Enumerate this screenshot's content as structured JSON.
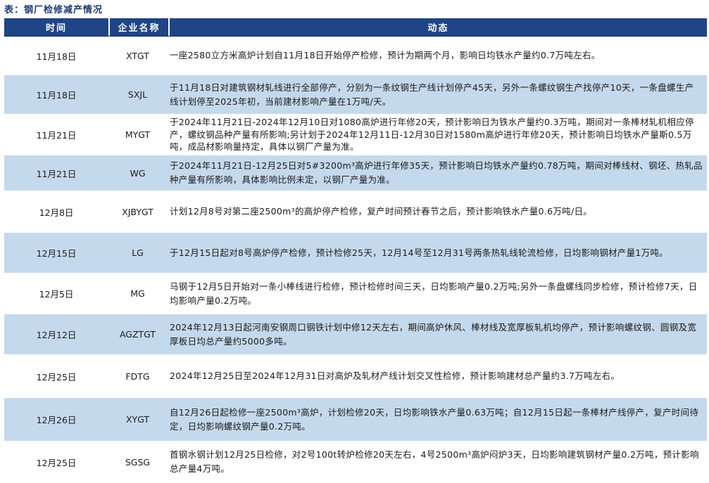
{
  "caption": "表：钢厂检修减产情况",
  "colors": {
    "header_bg": "#1f4586",
    "row_shade": "#c5d9ec",
    "caption": "#1f3a73"
  },
  "header": {
    "time": "时间",
    "company": "企业名称",
    "dynamic": "动态"
  },
  "rows": [
    {
      "time": "11月18日",
      "company": "XTGT",
      "dynamic": "一座2580立方米高炉计划自11月18日开始停产检修，预计为期两个月，影响日均铁水产量约0.7万吨左右。"
    },
    {
      "time": "11月18日",
      "company": "SXJL",
      "dynamic": "于11月18日对建筑钢材轧线进行全部停产，分别为一条纹钢生产线计划停产45天，另外一条螺纹钢生产找停产10天，一条盘螺生产线计划停至2025年初，当前建材影响产量在1万吨/天。"
    },
    {
      "time": "11月21日",
      "company": "MYGT",
      "dynamic": "于2024年11月21日-2024年12月10日对1080高炉进行年修20天，预计影响日为铁水产量约0.3万吨，期间对一条棒材轧机相应停产，螺纹钢品种产量有所影响;另计划于2024年12月11日-12月30日对1580m高炉进行年修20天，预计影响日均铁水产量斯0.5万吨，成品材影响量持定，具体以钢厂产量为准。"
    },
    {
      "time": "11月21日",
      "company": "WG",
      "dynamic": "于2024年11月21日-12月25日对5#3200m³高炉进行年修35天，预计影响日均铁水产量约0.78万吨，期间对棒线材、钢坯、热轧品种产量有所影响，具体影响比例未定，以钢厂产量为准。"
    },
    {
      "time": "12月8日",
      "company": "XJBYGT",
      "dynamic": "计划12月8号对第二座2500m³的高炉停产检修，复产时间预计春节之后，预计影响铁水产量0.6万吨/日。"
    },
    {
      "time": "12月15日",
      "company": "LG",
      "dynamic": "于12月15日起对8号高炉停产检修，预计检修25天，12月14号至12月31号两条热轧线轮流检修，日均影响钢材产量1万吨。"
    },
    {
      "time": "12月5日",
      "company": "MG",
      "dynamic": "马钢于12月5日开始对一条小棒线进行检修，预计检修时间三天，日均影响产量0.2万吨;另外一条盘螺线同步检修，预计检修7天，日均影响产量0.2万吨。"
    },
    {
      "time": "12月12日",
      "company": "AGZTGT",
      "dynamic": "2024年12月13日起河南安钢周口钢铁计划中修12天左右，期间高炉休风、棒材线及宽厚板轧机均停产，预计影响螺纹钢、圆钢及宽厚板日均总产量约5000多吨。"
    },
    {
      "time": "12月25日",
      "company": "FDTG",
      "dynamic": "2024年12月25日至2024年12月31日对高炉及轧材产线计划交叉性检修，预计影响建材总产量约3.7万吨左右。"
    },
    {
      "time": "12月26日",
      "company": "XYGT",
      "dynamic": "自12月26日起检修一座2500m³高炉，计划检修20天，日均影响铁水产量0.63万吨；自12月15日起一条棒材产线停产，复产时间待定，日均影响螺纹钢产量0.2万吨。"
    },
    {
      "time": "12月25日",
      "company": "SGSG",
      "dynamic": "首钢水钢计划12月25日检修，对2号100t转炉检修20天左右，4号2500m³高炉闷炉3天，日均影响建筑钢材产量0.2万吨，预计影响总产量4万吨。"
    }
  ]
}
